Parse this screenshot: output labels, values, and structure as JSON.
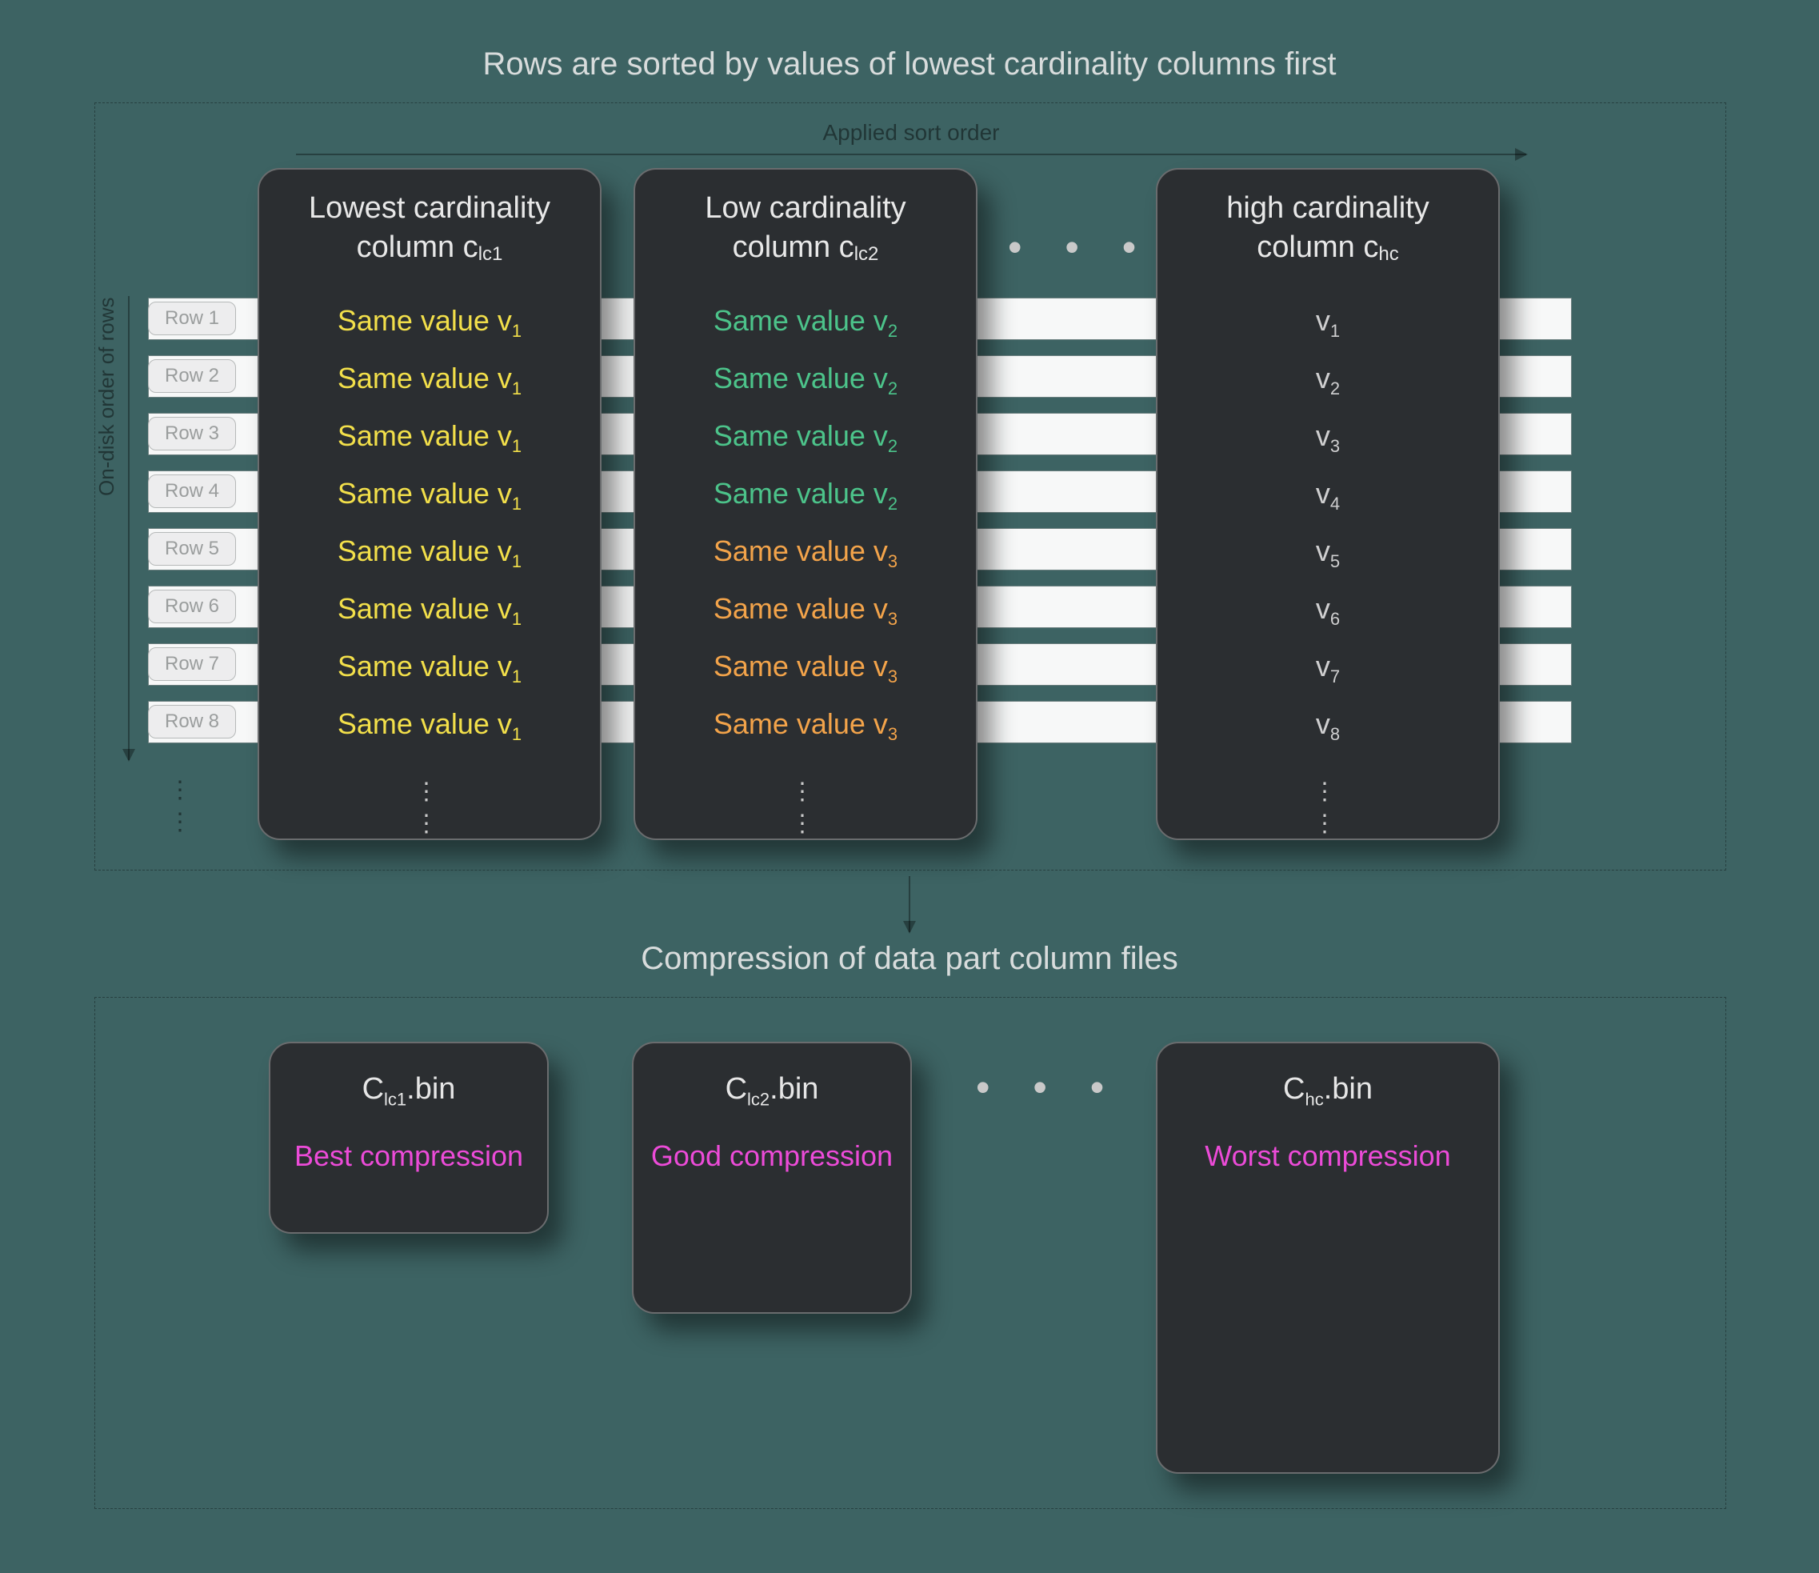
{
  "titles": {
    "top": "Rows are sorted by values of lowest cardinality columns first",
    "sort_order": "Applied sort order",
    "on_disk": "On-disk order of rows",
    "mid": "Compression of data part column files"
  },
  "row_labels": [
    "Row 1",
    "Row 2",
    "Row 3",
    "Row 4",
    "Row 5",
    "Row 6",
    "Row 7",
    "Row 8"
  ],
  "columns": {
    "c1": {
      "title_line1": "Lowest cardinality",
      "title_line2": "column c",
      "title_sub": "lc1"
    },
    "c2": {
      "title_line1": "Low cardinality",
      "title_line2": "column c",
      "title_sub": "lc2"
    },
    "c3": {
      "title_line1": "high cardinality",
      "title_line2": "column c",
      "title_sub": "hc"
    }
  },
  "cells": {
    "c1": [
      {
        "text": "Same value v",
        "sub": "1"
      },
      {
        "text": "Same value v",
        "sub": "1"
      },
      {
        "text": "Same value v",
        "sub": "1"
      },
      {
        "text": "Same value v",
        "sub": "1"
      },
      {
        "text": "Same value v",
        "sub": "1"
      },
      {
        "text": "Same value v",
        "sub": "1"
      },
      {
        "text": "Same value v",
        "sub": "1"
      },
      {
        "text": "Same value v",
        "sub": "1"
      }
    ],
    "c2": [
      {
        "text": "Same value v",
        "sub": "2",
        "cls": "green"
      },
      {
        "text": "Same value v",
        "sub": "2",
        "cls": "green"
      },
      {
        "text": "Same value v",
        "sub": "2",
        "cls": "green"
      },
      {
        "text": "Same value v",
        "sub": "2",
        "cls": "green"
      },
      {
        "text": "Same value v",
        "sub": "3",
        "cls": "orange"
      },
      {
        "text": "Same value v",
        "sub": "3",
        "cls": "orange"
      },
      {
        "text": "Same value v",
        "sub": "3",
        "cls": "orange"
      },
      {
        "text": "Same value v",
        "sub": "3",
        "cls": "orange"
      }
    ],
    "c3": [
      {
        "text": "v",
        "sub": "1"
      },
      {
        "text": "v",
        "sub": "2"
      },
      {
        "text": "v",
        "sub": "3"
      },
      {
        "text": "v",
        "sub": "4"
      },
      {
        "text": "v",
        "sub": "5"
      },
      {
        "text": "v",
        "sub": "6"
      },
      {
        "text": "v",
        "sub": "7"
      },
      {
        "text": "v",
        "sub": "8"
      }
    ]
  },
  "bins": {
    "b1": {
      "file_pre": "C",
      "file_sub": "lc1",
      "file_post": ".bin",
      "desc": "Best compression"
    },
    "b2": {
      "file_pre": "C",
      "file_sub": "lc2",
      "file_post": ".bin",
      "desc": "Good compression"
    },
    "b3": {
      "file_pre": "C",
      "file_sub": "hc",
      "file_post": ".bin",
      "desc": "Worst compression"
    }
  },
  "glyphs": {
    "hdots": "• • •",
    "vdots": "⋮"
  }
}
